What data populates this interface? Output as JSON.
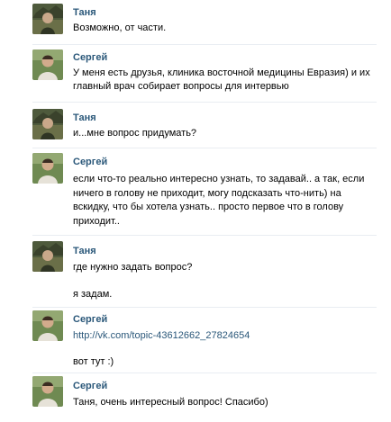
{
  "messages": [
    {
      "author": "Таня",
      "avatar": "tanya-avatar",
      "lines": [
        "Возможно, от части."
      ]
    },
    {
      "author": "Сергей",
      "avatar": "sergey-avatar",
      "lines": [
        "У меня есть друзья, клиника восточной медицины Евразия) и их",
        "главный врач собирает вопросы для интервью"
      ]
    },
    {
      "author": "Таня",
      "avatar": "tanya-avatar",
      "lines": [
        "и...мне вопрос придумать?"
      ]
    },
    {
      "author": "Сергей",
      "avatar": "sergey-avatar",
      "lines": [
        "если что-то реально интересно узнать, то задавай.. а так, если",
        "ничего в голову не приходит, могу подсказать что-нить) на",
        "вскидку, что бы хотела узнать.. просто первое что в голову",
        "приходит.."
      ]
    },
    {
      "author": "Таня",
      "avatar": "tanya-avatar",
      "lines": [
        "где нужно задать вопрос?",
        "я задам."
      ]
    },
    {
      "author": "Сергей",
      "avatar": "sergey-avatar",
      "link": "http://vk.com/topic-43612662_27824654",
      "lines": [
        "вот тут :)"
      ]
    },
    {
      "author": "Сергей",
      "avatar": "sergey-avatar",
      "lines": [
        "Таня, очень интересный вопрос! Спасибо)"
      ]
    }
  ],
  "colors": {
    "author": "#2b587a",
    "link": "#2b587a",
    "text": "#000000",
    "separator": "#e9edf2"
  }
}
